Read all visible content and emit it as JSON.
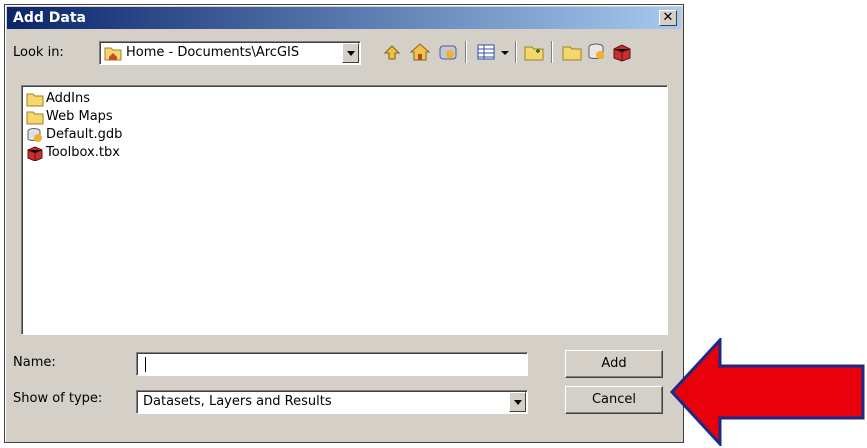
{
  "window": {
    "title": "Add Data",
    "close_label": "✕"
  },
  "look_in": {
    "label": "Look in:",
    "value": "Home - Documents\\ArcGIS"
  },
  "toolbar_icons": [
    "up-one-level-icon",
    "home-icon",
    "catalog-connect-icon",
    "view-list-icon",
    "view-dropdown-icon",
    "new-folder-icon",
    "connect-folder-icon",
    "new-geodatabase-icon",
    "toolbox-icon"
  ],
  "files": [
    {
      "name": "AddIns",
      "icon": "folder-icon"
    },
    {
      "name": "Web Maps",
      "icon": "folder-icon"
    },
    {
      "name": "Default.gdb",
      "icon": "geodatabase-icon"
    },
    {
      "name": "Toolbox.tbx",
      "icon": "toolbox-icon"
    }
  ],
  "name_field": {
    "label": "Name:",
    "value": ""
  },
  "type_field": {
    "label": "Show of type:",
    "value": "Datasets, Layers and Results"
  },
  "buttons": {
    "add": "Add",
    "cancel": "Cancel"
  },
  "colors": {
    "titlebar": "#0a246a",
    "dialog": "#d4d0c8",
    "arrow": "#e8000b",
    "arrow_outline": "#1a2a8a"
  }
}
